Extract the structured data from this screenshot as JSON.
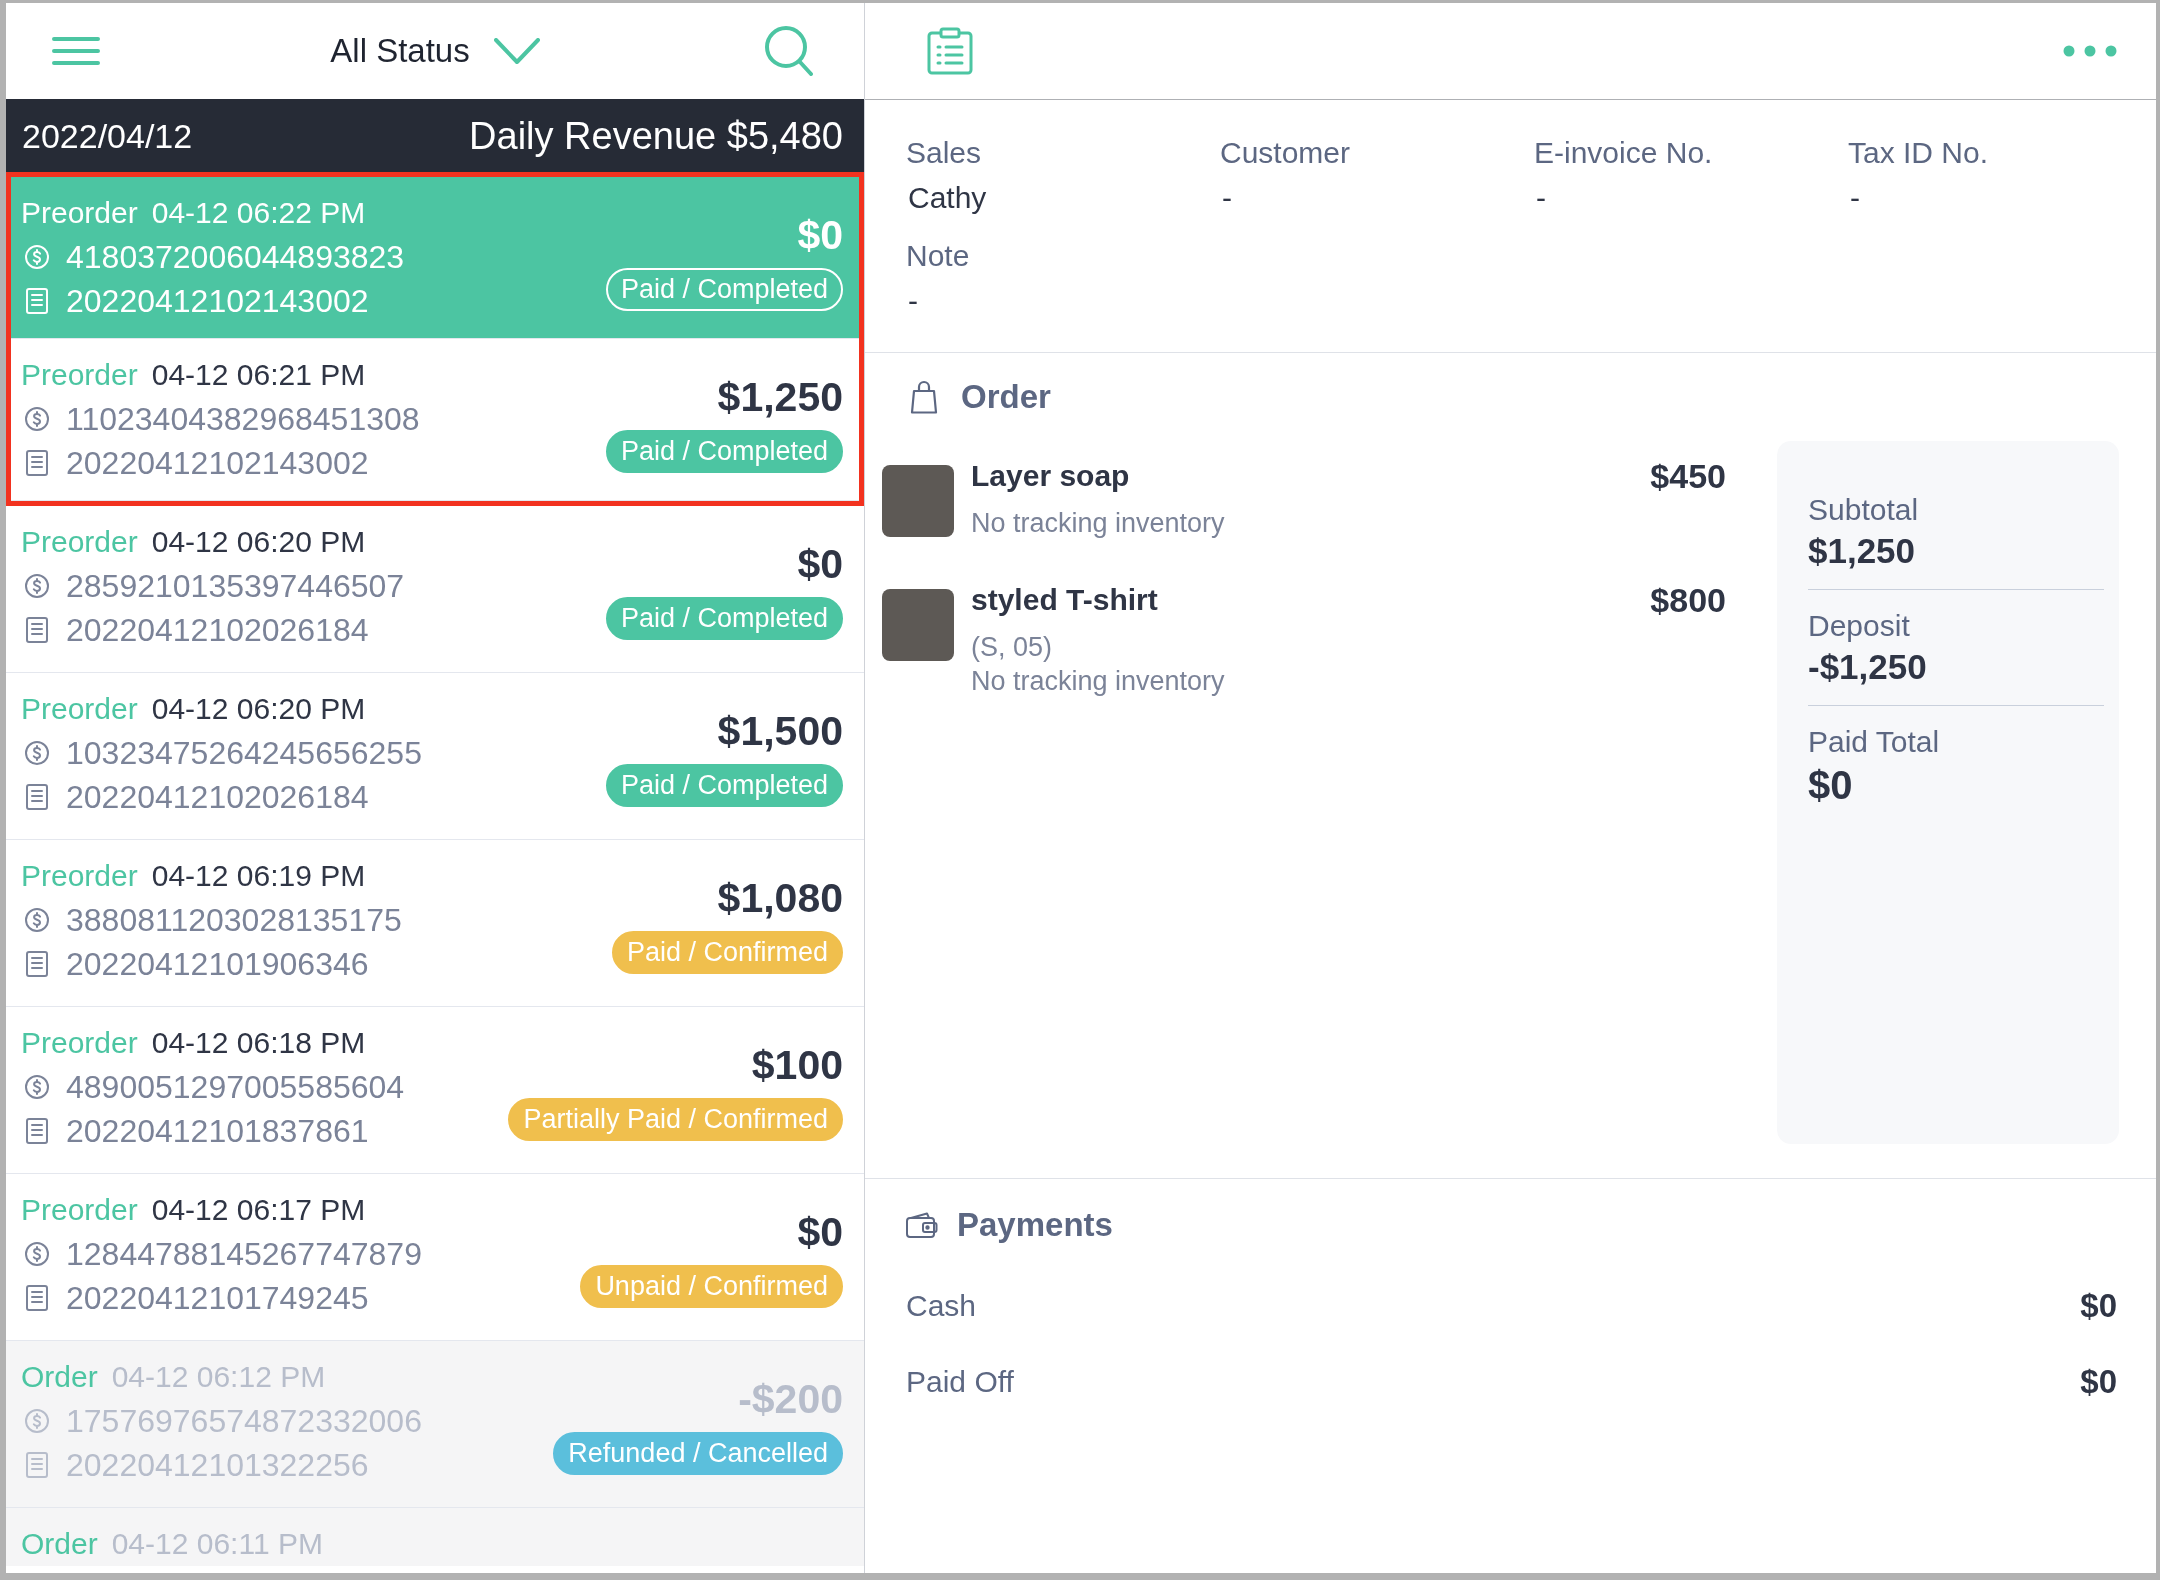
{
  "list_header": {
    "filter": "All Status"
  },
  "date_bar": {
    "date": "2022/04/12",
    "revenue": "Daily Revenue $5,480"
  },
  "orders": [
    {
      "type": "Preorder",
      "time": "04-12 06:22 PM",
      "payment_no": "4180372006044893823",
      "order_no": "20220412102143002",
      "amount": "$0",
      "status": {
        "label": "Paid / Completed"
      },
      "selected": true,
      "highlighted": true,
      "dimmed": false
    },
    {
      "type": "Preorder",
      "time": "04-12 06:21 PM",
      "payment_no": "11023404382968451308",
      "order_no": "20220412102143002",
      "amount": "$1,250",
      "status": {
        "label": "Paid / Completed",
        "color": "#4cc5a2"
      },
      "selected": false,
      "highlighted": true,
      "dimmed": false
    },
    {
      "type": "Preorder",
      "time": "04-12 06:20 PM",
      "payment_no": "2859210135397446507",
      "order_no": "20220412102026184",
      "amount": "$0",
      "status": {
        "label": "Paid / Completed",
        "color": "#4cc5a2"
      },
      "selected": false,
      "highlighted": false,
      "dimmed": false
    },
    {
      "type": "Preorder",
      "time": "04-12 06:20 PM",
      "payment_no": "10323475264245656255",
      "order_no": "20220412102026184",
      "amount": "$1,500",
      "status": {
        "label": "Paid / Completed",
        "color": "#4cc5a2"
      },
      "selected": false,
      "highlighted": false,
      "dimmed": false
    },
    {
      "type": "Preorder",
      "time": "04-12 06:19 PM",
      "payment_no": "3880811203028135175",
      "order_no": "20220412101906346",
      "amount": "$1,080",
      "status": {
        "label": "Paid / Confirmed",
        "color": "#f0bf4d"
      },
      "selected": false,
      "highlighted": false,
      "dimmed": false
    },
    {
      "type": "Preorder",
      "time": "04-12 06:18 PM",
      "payment_no": "4890051297005585604",
      "order_no": "20220412101837861",
      "amount": "$100",
      "status": {
        "label": "Partially Paid / Confirmed",
        "color": "#f0bf4d"
      },
      "selected": false,
      "highlighted": false,
      "dimmed": false
    },
    {
      "type": "Preorder",
      "time": "04-12 06:17 PM",
      "payment_no": "12844788145267747879",
      "order_no": "20220412101749245",
      "amount": "$0",
      "status": {
        "label": "Unpaid / Confirmed",
        "color": "#f0bf4d"
      },
      "selected": false,
      "highlighted": false,
      "dimmed": false
    },
    {
      "type": "Order",
      "time": "04-12 06:12 PM",
      "payment_no": "17576976574872332006",
      "order_no": "20220412101322256",
      "amount": "-$200",
      "status": {
        "label": "Refunded / Cancelled",
        "color": "#5bbfdc"
      },
      "selected": false,
      "highlighted": false,
      "dimmed": true
    },
    {
      "type": "Order",
      "time": "04-12 06:11 PM",
      "selected": false,
      "highlighted": false,
      "dimmed": true
    }
  ],
  "detail": {
    "info": [
      {
        "label": "Sales",
        "value": "Cathy"
      },
      {
        "label": "Customer",
        "value": "-"
      },
      {
        "label": "E-invoice No.",
        "value": "-"
      },
      {
        "label": "Tax ID No.",
        "value": "-"
      },
      {
        "label": "Note",
        "value": "-"
      }
    ],
    "order": {
      "title": "Order",
      "items": [
        {
          "name": "Layer soap",
          "price": "$450",
          "note": "No tracking inventory"
        },
        {
          "name": "styled T-shirt",
          "variant": "(S, 05)",
          "price": "$800",
          "note": "No tracking inventory"
        }
      ],
      "summary": [
        {
          "kind": "line",
          "label": "Subtotal",
          "value": "$1,250"
        },
        {
          "kind": "line",
          "label": "Deposit",
          "value": "-$1,250"
        },
        {
          "kind": "total",
          "label": "Paid Total",
          "value": "$0"
        }
      ]
    },
    "payments": {
      "title": "Payments",
      "rows": [
        {
          "label": "Cash",
          "value": "$0"
        },
        {
          "label": "Paid Off",
          "value": "$0"
        }
      ]
    }
  }
}
